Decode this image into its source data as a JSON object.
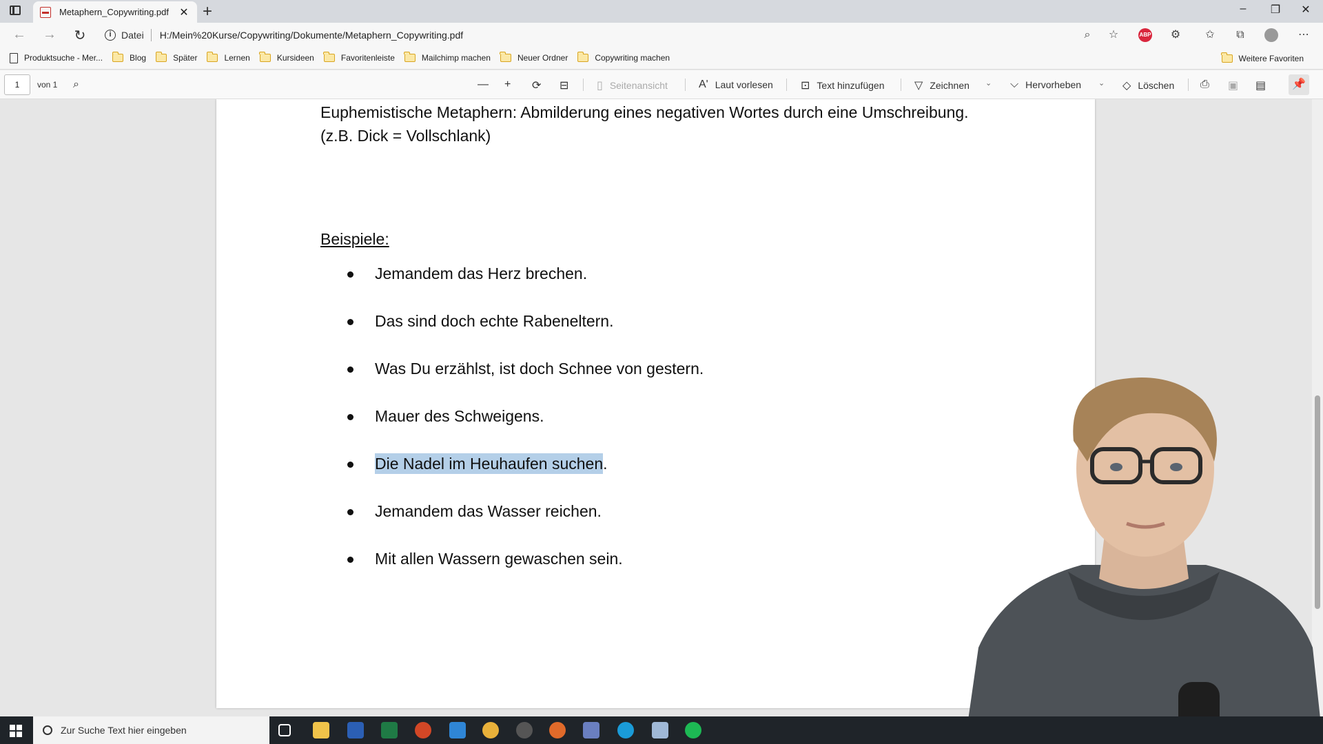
{
  "browser": {
    "tab_title": "Metaphern_Copywriting.pdf",
    "url_label": "Datei",
    "url": "H:/Mein%20Kurse/Copywriting/Dokumente/Metaphern_Copywriting.pdf",
    "abp_label": "ABP"
  },
  "bookmarks": {
    "items": [
      "Produktsuche - Mer...",
      "Blog",
      "Später",
      "Lernen",
      "Kursideen",
      "Favoritenleiste",
      "Mailchimp machen",
      "Neuer Ordner",
      "Copywriting machen"
    ],
    "more": "Weitere Favoriten"
  },
  "pdf_toolbar": {
    "page_current": "1",
    "page_of": "von 1",
    "page_view": "Seitenansicht",
    "read_aloud": "Laut vorlesen",
    "add_text": "Text hinzufügen",
    "draw": "Zeichnen",
    "highlight": "Hervorheben",
    "erase": "Löschen"
  },
  "document": {
    "intro_line1": "Euphemistische Metaphern: Abmilderung eines negativen Wortes durch eine Umschreibung.",
    "intro_line2": "(z.B. Dick = Vollschlank)",
    "heading": "Beispiele:",
    "examples": [
      "Jemandem das Herz brechen.",
      "Das sind doch echte Rabeneltern.",
      "Was Du erzählst, ist doch Schnee von gestern.",
      "Mauer des Schweigens.",
      "Die Nadel im Heuhaufen suchen",
      "Jemandem das Wasser reichen.",
      "Mit allen Wassern gewaschen sein."
    ],
    "highlight_suffix": "."
  },
  "taskbar": {
    "search_placeholder": "Zur Suche Text hier eingeben"
  },
  "colors": {
    "highlight": "#b4cfe8",
    "taskbar": "#1f2429",
    "abp": "#d9263d"
  }
}
